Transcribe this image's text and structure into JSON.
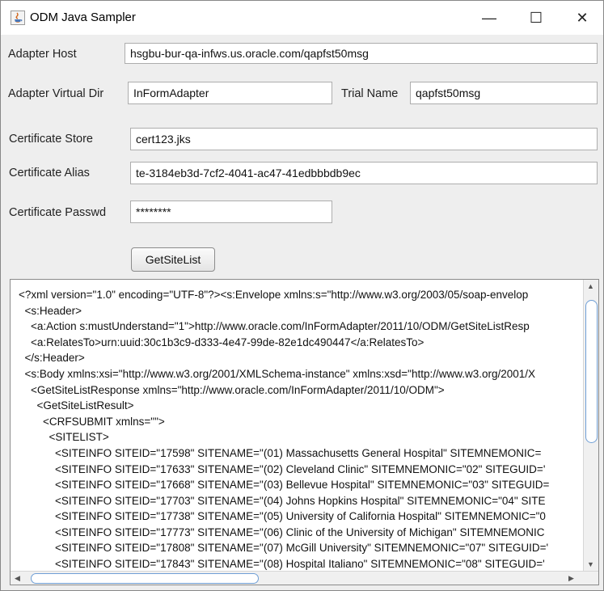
{
  "window": {
    "title": "ODM Java Sampler",
    "minimize_glyph": "—",
    "maximize_glyph": "☐",
    "close_glyph": "✕",
    "icon": "java-icon"
  },
  "form": {
    "adapter_host_label": "Adapter Host",
    "adapter_host_value": "hsgbu-bur-qa-infws.us.oracle.com/qapfst50msg",
    "adapter_dir_label": "Adapter Virtual Dir",
    "adapter_dir_value": "InFormAdapter",
    "trial_name_label": "Trial Name",
    "trial_name_value": "qapfst50msg",
    "cert_store_label": "Certificate Store",
    "cert_store_value": "cert123.jks",
    "cert_alias_label": "Certificate Alias",
    "cert_alias_value": "te-3184eb3d-7cf2-4041-ac47-41edbbbdb9ec",
    "cert_passwd_label": "Certificate Passwd",
    "cert_passwd_value": "********",
    "get_button_label": "GetSiteList"
  },
  "xml": {
    "lines": [
      "<?xml version=\"1.0\" encoding=\"UTF-8\"?><s:Envelope xmlns:s=\"http://www.w3.org/2003/05/soap-envelop",
      "  <s:Header>",
      "    <a:Action s:mustUnderstand=\"1\">http://www.oracle.com/InFormAdapter/2011/10/ODM/GetSiteListResp",
      "    <a:RelatesTo>urn:uuid:30c1b3c9-d333-4e47-99de-82e1dc490447</a:RelatesTo>",
      "  </s:Header>",
      "  <s:Body xmlns:xsi=\"http://www.w3.org/2001/XMLSchema-instance\" xmlns:xsd=\"http://www.w3.org/2001/X",
      "    <GetSiteListResponse xmlns=\"http://www.oracle.com/InFormAdapter/2011/10/ODM\">",
      "      <GetSiteListResult>",
      "        <CRFSUBMIT xmlns=\"\">",
      "          <SITELIST>",
      "            <SITEINFO SITEID=\"17598\" SITENAME=\"(01) Massachusetts General Hospital\" SITEMNEMONIC=",
      "            <SITEINFO SITEID=\"17633\" SITENAME=\"(02) Cleveland Clinic\" SITEMNEMONIC=\"02\" SITEGUID='",
      "            <SITEINFO SITEID=\"17668\" SITENAME=\"(03) Bellevue Hospital\" SITEMNEMONIC=\"03\" SITEGUID=",
      "            <SITEINFO SITEID=\"17703\" SITENAME=\"(04) Johns Hopkins Hospital\" SITEMNEMONIC=\"04\" SITE",
      "            <SITEINFO SITEID=\"17738\" SITENAME=\"(05) University of California Hospital\" SITEMNEMONIC=\"0",
      "            <SITEINFO SITEID=\"17773\" SITENAME=\"(06) Clinic of the University of Michigan\" SITEMNEMONIC",
      "            <SITEINFO SITEID=\"17808\" SITENAME=\"(07) McGill University\" SITEMNEMONIC=\"07\" SITEGUID='",
      "            <SITEINFO SITEID=\"17843\" SITENAME=\"(08) Hospital Italiano\" SITEMNEMONIC=\"08\" SITEGUID='"
    ]
  },
  "scrollbar": {
    "up_arrow": "▲",
    "down_arrow": "▼",
    "left_arrow": "◀",
    "right_arrow": "▶"
  }
}
